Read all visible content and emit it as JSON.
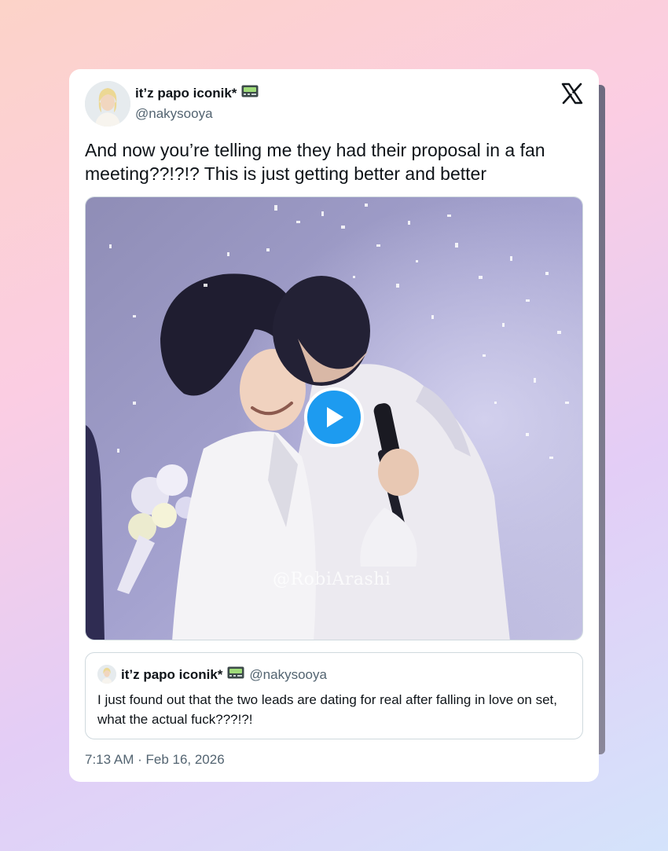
{
  "tweet": {
    "display_name": "it’z papo iconik*",
    "handle": "@nakysooya",
    "text": "And now you’re telling me they had their proposal in a fan meeting??!?!? This is just getting better and better",
    "timestamp": "7:13 AM · Feb 16, 2026",
    "brand_logo": "x-logo",
    "name_emoji": "pager-icon"
  },
  "media": {
    "type": "video",
    "play_icon": "play-icon",
    "watermark": "@RobiArashi",
    "accent": "#1d9bf0"
  },
  "quoted_tweet": {
    "display_name": "it’z papo iconik*",
    "handle": "@nakysooya",
    "text": "I just found out that the two leads are dating for real after falling in love on set, what the actual fuck???!?!"
  }
}
